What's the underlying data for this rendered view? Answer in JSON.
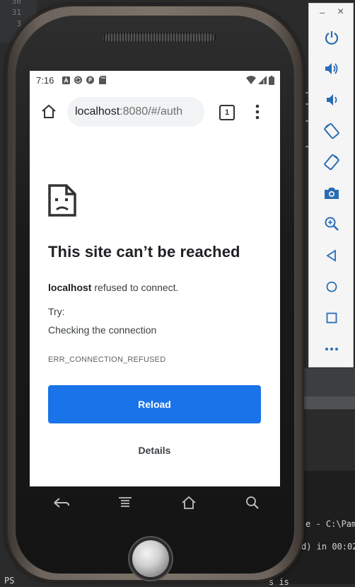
{
  "ide": {
    "line_numbers": [
      "30",
      "31",
      "3"
    ],
    "terminal_lines": [
      "e - C:\\Pam",
      "d) in 00:02",
      "PS",
      "s is"
    ]
  },
  "status_bar": {
    "time": "7:16",
    "notification_icons": [
      "accessibility-icon",
      "sync-icon",
      "app-icon",
      "sd-card-icon"
    ],
    "system_icons": [
      "wifi-icon",
      "signal-icon",
      "battery-icon"
    ]
  },
  "browser": {
    "url_host": "localhost",
    "url_path": ":8080/#/auth",
    "tab_count": "1"
  },
  "error_page": {
    "title": "This site can’t be reached",
    "message_host": "localhost",
    "message_rest": " refused to connect.",
    "try_label": "Try:",
    "suggestion": "Checking the connection",
    "error_code": "ERR_CONNECTION_REFUSED",
    "reload_label": "Reload",
    "details_label": "Details"
  },
  "emulator_toolbar": {
    "minimize": "–",
    "close": "×",
    "buttons": [
      "power-icon",
      "volume-up-icon",
      "volume-down-icon",
      "rotate-left-icon",
      "rotate-right-icon",
      "camera-icon",
      "zoom-icon",
      "back-icon",
      "home-icon",
      "overview-icon",
      "more-icon"
    ]
  },
  "colors": {
    "accent": "#1a73e8",
    "ide_background": "#2b2b2b",
    "toolbar_icon": "#1e73c8"
  }
}
